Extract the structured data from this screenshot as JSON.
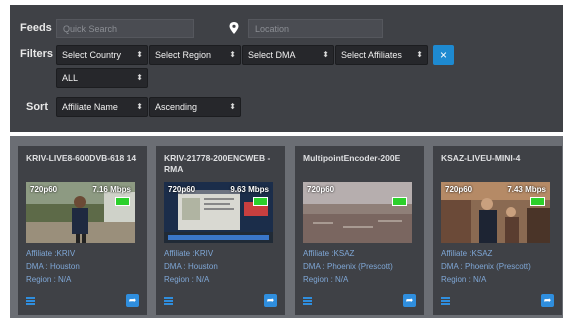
{
  "filters_panel": {
    "feeds_label": "Feeds",
    "search_placeholder": "Quick Search",
    "location_placeholder": "Location",
    "filters_label": "Filters",
    "country": "Select Country",
    "region": "Select Region",
    "dma": "Select DMA",
    "affiliates": "Select Affiliates",
    "clear_label": "×",
    "all": "ALL",
    "sort_label": "Sort",
    "sort_field": "Affiliate Name",
    "sort_order": "Ascending"
  },
  "icons": {
    "location": "map-pin",
    "clear": "close",
    "dropdown": "up-down-arrows",
    "list": "list",
    "share": "share-arrow"
  },
  "colors": {
    "panel": "#3f4146",
    "accent": "#2f8ede",
    "battery": "#2bd02b",
    "info_text": "#7fa7d6"
  },
  "cards": [
    {
      "title": "KRIV-LIVE8-600DVB-618 14",
      "resolution": "720p60",
      "bitrate": "7.16 Mbps",
      "affiliate": "Affiliate :KRIV",
      "dma": "DMA : Houston",
      "region": "Region : N/A"
    },
    {
      "title": "KRIV-21778-200ENCWEB -RMA",
      "resolution": "720p60",
      "bitrate": "9.63 Mbps",
      "affiliate": "Affiliate :KRIV",
      "dma": "DMA : Houston",
      "region": "Region : N/A"
    },
    {
      "title": "MultipointEncoder-200E",
      "resolution": "720p60",
      "bitrate": "",
      "affiliate": "Affiliate :KSAZ",
      "dma": "DMA : Phoenix (Prescott)",
      "region": "Region : N/A"
    },
    {
      "title": "KSAZ-LIVEU-MINI-4",
      "resolution": "720p60",
      "bitrate": "7.43 Mbps",
      "affiliate": "Affiliate :KSAZ",
      "dma": "DMA : Phoenix (Prescott)",
      "region": "Region : N/A"
    }
  ]
}
